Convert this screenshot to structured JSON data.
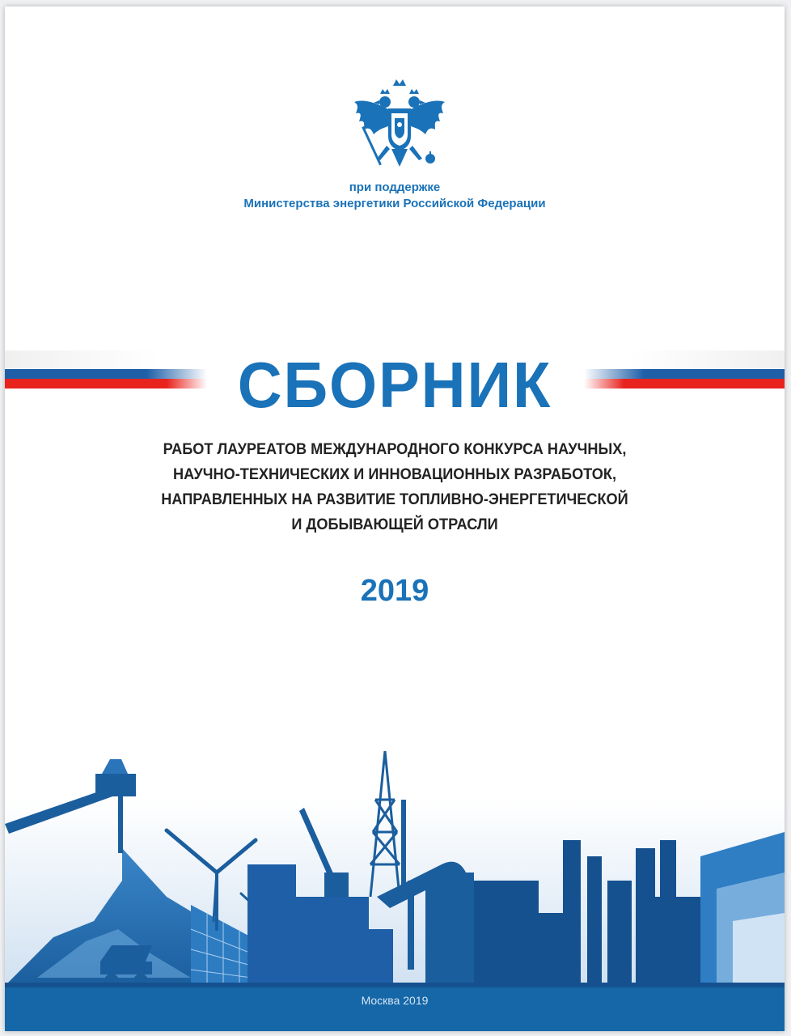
{
  "header": {
    "support_line1": "при поддержке",
    "support_line2": "Министерства энергетики Российской Федерации",
    "emblem_icon": "double-headed-eagle-emblem"
  },
  "title": "СБОРНИК",
  "subtitle_lines": [
    "РАБОТ ЛАУРЕАТОВ МЕЖДУНАРОДНОГО КОНКУРСА НАУЧНЫХ,",
    "НАУЧНО-ТЕХНИЧЕСКИХ И ИННОВАЦИОННЫХ РАЗРАБОТОК,",
    "НАПРАВЛЕННЫХ НА РАЗВИТИЕ ТОПЛИВНО-ЭНЕРГЕТИЧЕСКОЙ",
    "И ДОБЫВАЮЩЕЙ ОТРАСЛИ"
  ],
  "year": "2019",
  "footer": {
    "city": "Москва 2019"
  },
  "colors": {
    "brand_blue": "#1a72b8",
    "flag_blue": "#1e5fa8",
    "flag_red": "#e8231e",
    "footer_blue": "#1567a8",
    "text_dark": "#232323"
  }
}
